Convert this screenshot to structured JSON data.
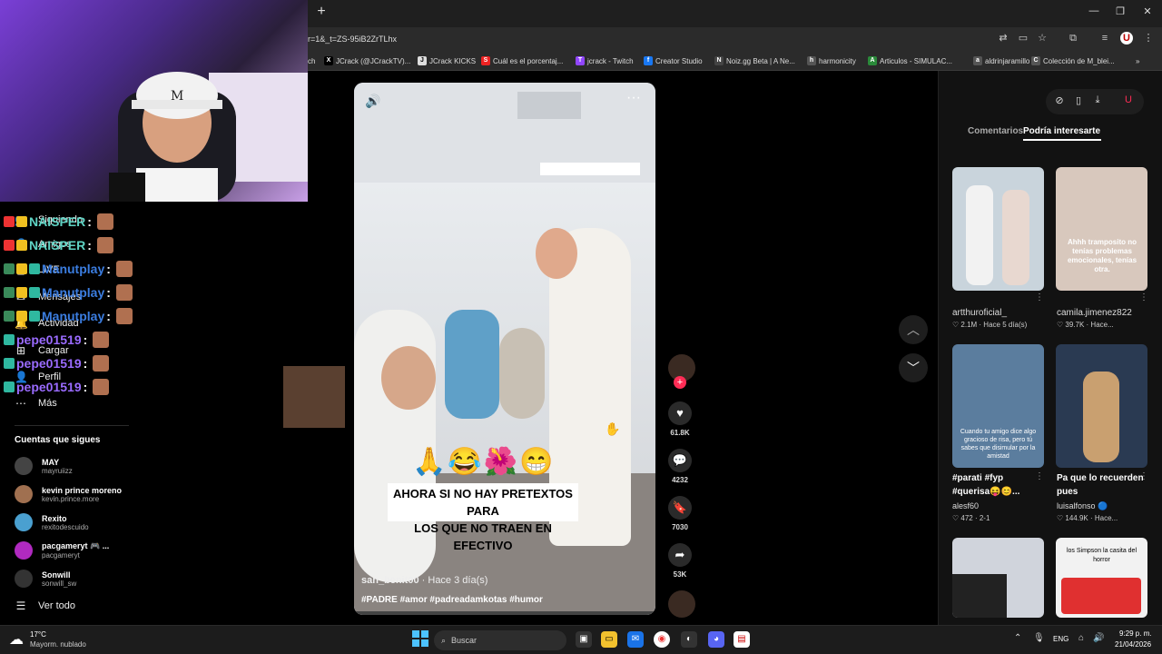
{
  "browser": {
    "new_tab_label": "+",
    "url": "r=1&_t=ZS-95iB2ZrTLhx",
    "window_controls": [
      "—",
      "❐",
      "✕"
    ],
    "bookmarks": [
      {
        "label": "ch",
        "icon": ""
      },
      {
        "label": "JCrack (@JCrackTV)...",
        "icon": "X"
      },
      {
        "label": "JCrack KICKS",
        "icon": "J"
      },
      {
        "label": "Cuál es el porcentaj...",
        "icon": "S"
      },
      {
        "label": "jcrack - Twitch",
        "icon": "T"
      },
      {
        "label": "Creator Studio",
        "icon": "f"
      },
      {
        "label": "Noiz.gg Beta | A Ne...",
        "icon": "N"
      },
      {
        "label": "harmonicity",
        "icon": "h"
      },
      {
        "label": "Articulos - SIMULAC...",
        "icon": "A"
      },
      {
        "label": "aldrinjaramillo",
        "icon": "a"
      },
      {
        "label": "Colección de M_blei...",
        "icon": "C"
      }
    ],
    "bookmarks_more": "»"
  },
  "chat": [
    {
      "user": "NAISPER",
      "color": "#5fd3c4",
      "sep": ":"
    },
    {
      "user": "NAISPER",
      "color": "#5fd3c4",
      "sep": ":"
    },
    {
      "user": "Manutplay",
      "color": "#3b7de0",
      "sep": ":"
    },
    {
      "user": "Manutplay",
      "color": "#3b7de0",
      "sep": ":"
    },
    {
      "user": "Manutplay",
      "color": "#3b7de0",
      "sep": ":"
    },
    {
      "user": "pepe01519",
      "color": "#9a6bff",
      "sep": ":"
    },
    {
      "user": "pepe01519",
      "color": "#9a6bff",
      "sep": ":"
    },
    {
      "user": "pepe01519",
      "color": "#9a6bff",
      "sep": ":"
    }
  ],
  "sidebar": {
    "nav": [
      {
        "label": "Siguiendo",
        "icon": "👥"
      },
      {
        "label": "Amigos",
        "icon": "👤"
      },
      {
        "label": "LIVE",
        "icon": "▢"
      },
      {
        "label": "Mensajes",
        "icon": "✉"
      },
      {
        "label": "Actividad",
        "icon": "🔔"
      },
      {
        "label": "Cargar",
        "icon": "⊞"
      },
      {
        "label": "Perfil",
        "icon": "👤"
      },
      {
        "label": "Más",
        "icon": "⋯"
      }
    ],
    "following_title": "Cuentas que sigues",
    "accounts": [
      {
        "name": "MAY",
        "user": "mayruiizz",
        "color": "#444"
      },
      {
        "name": "kevin prince moreno",
        "user": "kevin.prince.more",
        "color": "#a07050"
      },
      {
        "name": "Rexito",
        "user": "rexitodescuido",
        "color": "#4aa0d0"
      },
      {
        "name": "pacgameryt 🎮 ...",
        "user": "pacgameryt",
        "color": "#b02ac0"
      },
      {
        "name": "Sonwill",
        "user": "sonwill_sw",
        "color": "#333"
      }
    ],
    "see_all": "Ver todo"
  },
  "video": {
    "caption_line1": "AHORA SI NO HAY PRETEXTOS PARA",
    "caption_line2": "LOS QUE NO TRAEN EN EFECTIVO",
    "emojis": "🙏😂🌺😁",
    "author": "san_benit00",
    "time_ago": " · Hace 3 día(s)",
    "tags": "#PADRE #amor #padreadamkotas #humor",
    "volume_icon": "🔊",
    "more_icon": "···"
  },
  "actions": {
    "like_count": "61.8K",
    "comment_count": "4232",
    "save_count": "7030",
    "share_count": "53K",
    "follow_plus": "+"
  },
  "right_panel": {
    "tab_comments": "Comentarios",
    "tab_interest": "Podría interesarte",
    "items": [
      {
        "desc": "",
        "user": "artthuroficial_",
        "stats": "♡ 2.1M  · Hace 5 día(s)",
        "overlay": "",
        "bg": "#c9d4dc"
      },
      {
        "desc": "",
        "user": "camila.jimenez822",
        "stats": "♡ 39.7K  · Hace...",
        "overlay": "Ahhh tramposito no tenías problemas emocionales, tenías otra.",
        "bg": "#d8c8bd"
      },
      {
        "desc": "#parati #fyp #querisa😝😊...",
        "user": "alesf60",
        "stats": "♡ 472  · 2-1",
        "overlay": "Cuando tu amigo dice algo gracioso de risa, pero tú sabes que disimular por la amistad",
        "bg": "#5b7d9e"
      },
      {
        "desc": "Pa que lo recuerden pues",
        "user": "luisalfonso 🔵",
        "stats": "♡ 144.9K  · Hace...",
        "overlay": "",
        "bg": "#2a3a52"
      },
      {
        "desc": "",
        "user": "",
        "stats": "",
        "overlay": "",
        "bg": "#d0d4dc"
      },
      {
        "desc": "",
        "user": "",
        "stats": "",
        "overlay": "los Simpson la casita del horror",
        "bg": "#f2f2f2"
      }
    ]
  },
  "taskbar": {
    "temp": "17°C",
    "weather": "Mayorm. nublado",
    "search": "Buscar",
    "lang": "ENG",
    "time": "9:29 p. m.",
    "date": "21/04/2026"
  },
  "colors": {
    "accent_red": "#fe2c55",
    "chrome_bg": "#2b2b2b",
    "panel_bg": "#121212"
  }
}
